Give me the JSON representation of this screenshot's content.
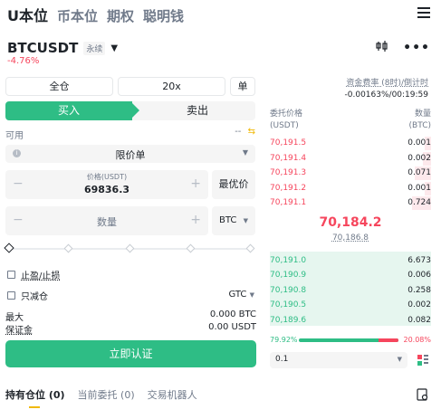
{
  "top_tabs": [
    "U本位",
    "币本位",
    "期权",
    "聪明钱"
  ],
  "symbol": {
    "name": "BTCUSDT",
    "badge": "永续",
    "change": "-4.76%"
  },
  "funding": {
    "label": "资金费率 (8时)/倒计时",
    "value": "-0.00163%/00:19:59"
  },
  "margin_mode": "全仓",
  "leverage": "20x",
  "mode_btn": "单",
  "sides": {
    "buy": "买入",
    "sell": "卖出"
  },
  "available": {
    "label": "可用",
    "value": "--"
  },
  "order_type": "限价单",
  "price": {
    "label": "价格(USDT)",
    "value": "69836.3",
    "best": "最优价"
  },
  "quantity": {
    "placeholder": "数量",
    "unit": "BTC"
  },
  "tp_sl": "止盈/止损",
  "reduce_only": "只减仓",
  "time_in_force": "GTC",
  "max": {
    "label": "最大",
    "value": "0.000 BTC"
  },
  "margin": {
    "label": "保证金",
    "value": "0.00 USDT"
  },
  "cta": "立即认证",
  "bottom_tabs": {
    "positions": "持有仓位 (0)",
    "orders": "当前委托 (0)",
    "bots": "交易机器人"
  },
  "orderbook": {
    "price_header": "委托价格\n(USDT)",
    "qty_header": "数量\n(BTC)",
    "price_h1": "委托价格",
    "price_h2": "(USDT)",
    "qty_h1": "数量",
    "qty_h2": "(BTC)",
    "asks": [
      {
        "price": "70,191.5",
        "qty": "0.001",
        "depth": 0.04
      },
      {
        "price": "70,191.4",
        "qty": "0.002",
        "depth": 0.05
      },
      {
        "price": "70,191.3",
        "qty": "0.071",
        "depth": 0.1
      },
      {
        "price": "70,191.2",
        "qty": "0.001",
        "depth": 0.04
      },
      {
        "price": "70,191.1",
        "qty": "0.724",
        "depth": 0.12
      }
    ],
    "mid_price": "70,184.2",
    "mark_price": "70,186.8",
    "bids": [
      {
        "price": "70,191.0",
        "qty": "6.673"
      },
      {
        "price": "70,190.9",
        "qty": "0.006"
      },
      {
        "price": "70,190.8",
        "qty": "0.258"
      },
      {
        "price": "70,190.5",
        "qty": "0.002"
      },
      {
        "price": "70,189.6",
        "qty": "0.082"
      }
    ],
    "buy_ratio": "79.92%",
    "sell_ratio": "20.08%",
    "buy_fraction": 0.7992,
    "precision": "0.1"
  },
  "colors": {
    "buy": "#2ebd85",
    "sell": "#f6465d",
    "accent": "#f0b90b"
  }
}
